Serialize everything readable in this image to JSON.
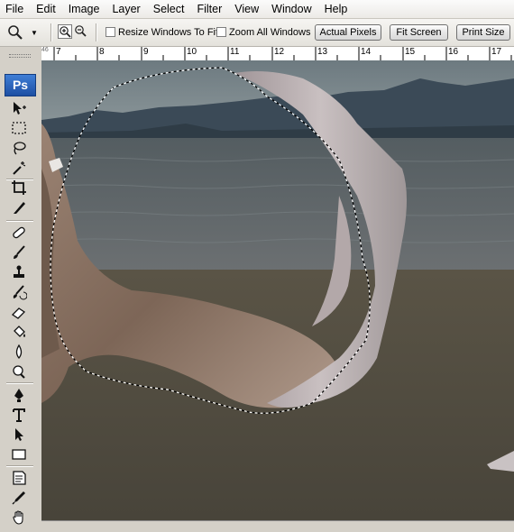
{
  "menubar": {
    "items": [
      "File",
      "Edit",
      "Image",
      "Layer",
      "Select",
      "Filter",
      "View",
      "Window",
      "Help"
    ]
  },
  "options": {
    "tool_icon": "zoom-magnifier-icon",
    "resize_windows_label": "Resize Windows To Fit",
    "resize_windows_checked": false,
    "zoom_all_label": "Zoom All Windows",
    "zoom_all_checked": false,
    "actual_pixels_label": "Actual Pixels",
    "fit_screen_label": "Fit Screen",
    "print_size_label": "Print Size"
  },
  "toolbox": {
    "logo_text": "Ps",
    "tools": [
      "move-tool-icon",
      "marquee-tool-icon",
      "lasso-tool-icon",
      "magic-wand-tool-icon",
      "crop-tool-icon",
      "slice-tool-icon",
      "healing-brush-tool-icon",
      "brush-tool-icon",
      "clone-stamp-tool-icon",
      "history-brush-tool-icon",
      "eraser-tool-icon",
      "paint-bucket-tool-icon",
      "blur-tool-icon",
      "dodge-tool-icon",
      "pen-tool-icon",
      "type-tool-icon",
      "path-selection-tool-icon",
      "rectangle-tool-icon",
      "notes-tool-icon",
      "eyedropper-tool-icon",
      "hand-tool-icon"
    ]
  },
  "ruler": {
    "origin_label": "46",
    "numbers": [
      "7",
      "8",
      "9",
      "10",
      "11",
      "12",
      "13",
      "14",
      "15",
      "16",
      "17"
    ]
  },
  "canvas": {
    "description_icon": "photo-canvas",
    "sky_color": "#7a8487",
    "sea_color": "#5c6466",
    "sand_color": "#4f4a3f"
  }
}
